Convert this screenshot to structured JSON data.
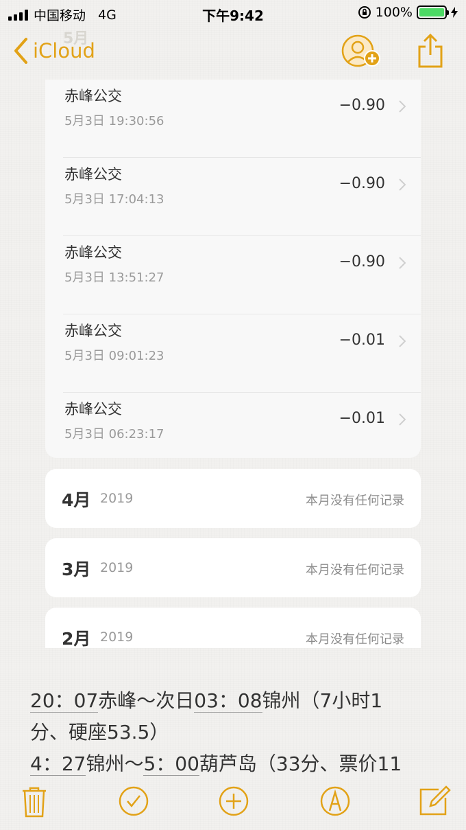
{
  "status_bar": {
    "carrier": "中国移动",
    "network": "4G",
    "time": "下午9:42",
    "battery": "100%",
    "battery_level": 1.0
  },
  "nav": {
    "back_label": "iCloud",
    "back_icon": "chevron-left-icon",
    "add_person_icon": "add-person-icon",
    "share_icon": "share-icon",
    "accent_color": "#e2a217"
  },
  "pasted_image": {
    "ghost_month": "5月",
    "transactions": [
      {
        "name": "赤峰公交",
        "time": "5月3日 19:30:56",
        "amount": "−0.90"
      },
      {
        "name": "赤峰公交",
        "time": "5月3日 17:04:13",
        "amount": "−0.90"
      },
      {
        "name": "赤峰公交",
        "time": "5月3日 13:51:27",
        "amount": "−0.90"
      },
      {
        "name": "赤峰公交",
        "time": "5月3日 09:01:23",
        "amount": "−0.01"
      },
      {
        "name": "赤峰公交",
        "time": "5月3日 06:23:17",
        "amount": "−0.01"
      }
    ],
    "months": [
      {
        "month": "4月",
        "year": "2019",
        "note": "本月没有任何记录"
      },
      {
        "month": "3月",
        "year": "2019",
        "note": "本月没有任何记录"
      },
      {
        "month": "2月",
        "year": "2019",
        "note": "本月没有任何记录"
      }
    ]
  },
  "note": {
    "line1_a": "20：07",
    "line1_b": "赤峰～次日",
    "line1_c": "03：08",
    "line1_d": "锦州（7小时1",
    "line2": "分、硬座53.5）",
    "line3_a": "4：27",
    "line3_b": "锦州～",
    "line3_c": "5：00",
    "line3_d": "葫芦岛（33分、票价11"
  },
  "toolbar": {
    "trash_icon": "trash-icon",
    "checklist_icon": "checklist-icon",
    "add_icon": "add-icon",
    "markup_icon": "markup-icon",
    "compose_icon": "compose-icon"
  }
}
